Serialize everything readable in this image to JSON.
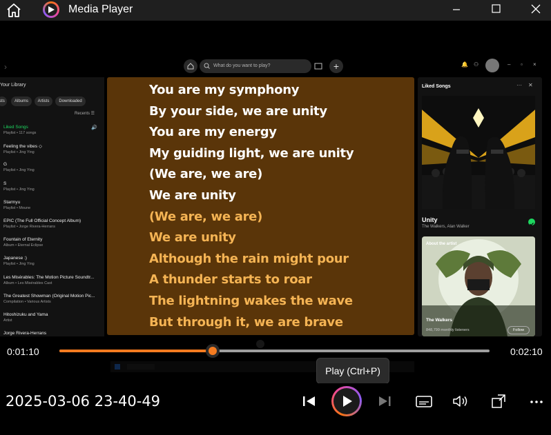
{
  "app": {
    "title": "Media Player"
  },
  "spotify": {
    "search_placeholder": "What do you want to play?",
    "library_title": "Your Library",
    "chips": [
      "sts",
      "Albums",
      "Artists",
      "Downloaded"
    ],
    "recents": "Recents",
    "items": [
      {
        "name": "Liked Songs",
        "sub": "Playlist • 117 songs",
        "active": true
      },
      {
        "name": "Feeling the vibes ◇",
        "sub": "Playlist • Jing Ying"
      },
      {
        "name": "G",
        "sub": "Playlist • Jing Ying"
      },
      {
        "name": "S",
        "sub": "Playlist • Jing Ying"
      },
      {
        "name": "Starmyu",
        "sub": "Playlist • Moune"
      },
      {
        "name": "EPIC (The Full Official Concept Album)",
        "sub": "Playlist • Jorge Rivera-Herrans"
      },
      {
        "name": "Fountain of Eternity",
        "sub": "Album • Eternal Eclipse"
      },
      {
        "name": "Japanese :)",
        "sub": "Playlist • Jing Ying"
      },
      {
        "name": "Les Misérables: The Motion Picture Soundtr...",
        "sub": "Album • Les Misérables Cast"
      },
      {
        "name": "The Greatest Showman (Original Motion Pic...",
        "sub": "Compilation • Various Artists"
      },
      {
        "name": "Hitoshizuku and Yama",
        "sub": "Artist"
      },
      {
        "name": "Jorge Rivera-Herrans",
        "sub": ""
      }
    ],
    "lyrics": [
      {
        "text": "You are my symphony",
        "state": "past"
      },
      {
        "text": "By your side, we are unity",
        "state": "past"
      },
      {
        "text": "You are my energy",
        "state": "past"
      },
      {
        "text": "My guiding light, we are unity",
        "state": "past"
      },
      {
        "text": "(We are, we are)",
        "state": "past"
      },
      {
        "text": "We are unity",
        "state": "past"
      },
      {
        "text": "(We are, we are)",
        "state": "future"
      },
      {
        "text": "We are unity",
        "state": "future"
      },
      {
        "text": "Although the rain might pour",
        "state": "future"
      },
      {
        "text": "A thunder starts to roar",
        "state": "future"
      },
      {
        "text": "The lightning wakes the wave",
        "state": "future"
      },
      {
        "text": "But through it, we are brave",
        "state": "future"
      }
    ],
    "right_panel": {
      "header": "Liked Songs",
      "song": "Unity",
      "artists": "The Walkers, Alan Walker",
      "about_label": "About the artist",
      "artist_name": "The Walkers",
      "listeners": "848,799 monthly listeners",
      "follow": "Follow"
    }
  },
  "player": {
    "current_time": "0:01:10",
    "total_time": "0:02:10",
    "progress_fraction": 0.356,
    "tooltip": "Play (Ctrl+P)",
    "datestamp": "2025-03-06 23-40-49",
    "accent": "#f47b20"
  }
}
